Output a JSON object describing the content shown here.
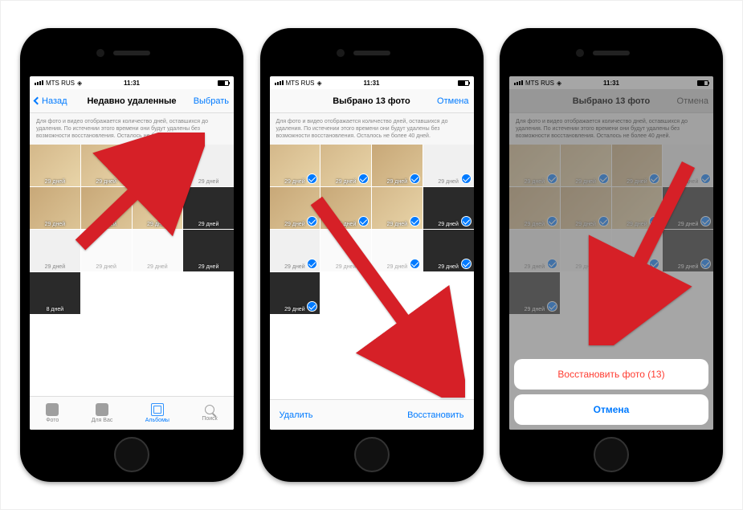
{
  "status": {
    "carrier": "MTS RUS",
    "time": "11:31",
    "wifi_icon": "wifi",
    "battery_icon": "battery"
  },
  "phone1": {
    "nav": {
      "back": "Назад",
      "title": "Недавно удаленные",
      "action": "Выбрать"
    },
    "desc": "Для фото и видео отображается количество дней, оставшихся до удаления. По истечении этого времени они будут удалены без возможности восстановления. Осталось не более 40 дней.",
    "days_label": "29 дней",
    "days_label_alt": "8 дней",
    "tabs": {
      "photos": "Фото",
      "for_you": "Для Вас",
      "albums": "Альбомы",
      "search": "Поиск"
    }
  },
  "phone2": {
    "nav": {
      "title": "Выбрано 13 фото",
      "action": "Отмена"
    },
    "desc": "Для фото и видео отображается количество дней, оставшихся до удаления. По истечении этого времени они будут удалены без возможности восстановления. Осталось не более 40 дней.",
    "days_label": "29 дней",
    "toolbar": {
      "delete": "Удалить",
      "restore": "Восстановить"
    }
  },
  "phone3": {
    "nav": {
      "title": "Выбрано 13 фото",
      "action": "Отмена"
    },
    "desc": "Для фото и видео отображается количество дней, оставшихся до удаления. По истечении этого времени они будут удалены без возможности восстановления. Осталось не более 40 дней.",
    "days_label": "29 дней",
    "sheet": {
      "restore": "Восстановить фото (13)",
      "cancel": "Отмена"
    }
  }
}
